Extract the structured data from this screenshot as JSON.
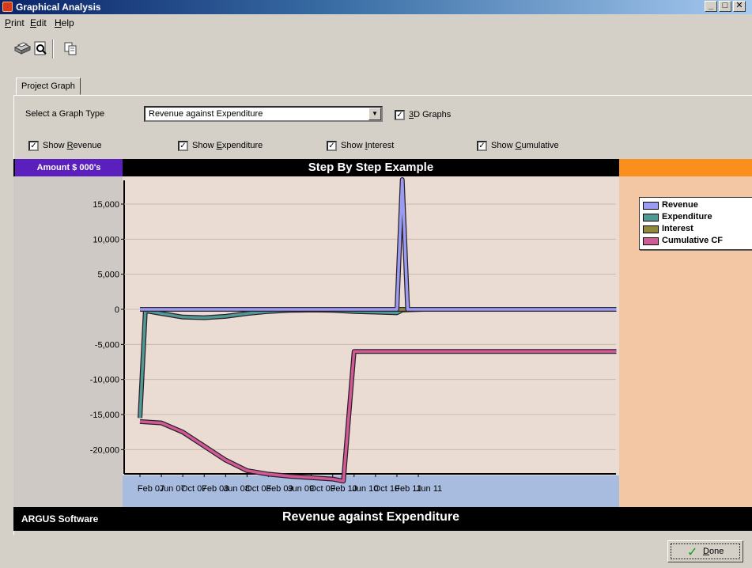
{
  "window": {
    "title": "Graphical Analysis",
    "minimize": "_",
    "maximize": "□",
    "close": "✕"
  },
  "menu": [
    {
      "key": "P",
      "rest": "rint"
    },
    {
      "key": "E",
      "rest": "dit",
      "pre": ""
    },
    {
      "key": "H",
      "rest": "elp"
    }
  ],
  "toolbar": {
    "icons": [
      "printer-icon",
      "print-preview-icon",
      "copy-icon"
    ]
  },
  "tab": {
    "label": "Project Graph"
  },
  "controls": {
    "graph_type_label": "Select a Graph Type",
    "graph_type_value": "Revenue against Expenditure",
    "graphs_3d": {
      "pre": "",
      "key": "3",
      "rest": "D Graphs",
      "checked": true
    },
    "show_revenue": {
      "pre": "Show ",
      "key": "R",
      "rest": "evenue",
      "checked": true
    },
    "show_expenditure": {
      "pre": "Show ",
      "key": "E",
      "rest": "xpenditure",
      "checked": true
    },
    "show_interest": {
      "pre": "Show ",
      "key": "I",
      "rest": "nterest",
      "checked": true
    },
    "show_cumulative": {
      "pre": "Show ",
      "key": "C",
      "rest": "umulative",
      "checked": true
    }
  },
  "chart_header": {
    "y_unit": "Amount $ 000's",
    "title": "Step By Step Example"
  },
  "footer": {
    "brand": "ARGUS Software",
    "title": "Revenue against Expenditure"
  },
  "done_button": {
    "key": "D",
    "rest": "one"
  },
  "colors": {
    "revenue": "#9a9cf2",
    "expenditure": "#4f9a94",
    "interest": "#8f8a3e",
    "cumulative": "#d05a96"
  },
  "chart_data": {
    "type": "line",
    "title": "Step By Step Example",
    "ylabel": "Amount $ 000's",
    "ylim": [
      -25000,
      20000
    ],
    "yticks": [
      15000,
      10000,
      5000,
      0,
      -5000,
      -10000,
      -15000,
      -20000
    ],
    "ytick_labels": [
      "15,000",
      "10,000",
      "5,000",
      "0",
      "-5,000",
      "-10,000",
      "-15,000",
      "-20,000"
    ],
    "x_tick_labels": [
      "Feb 07",
      "Jun 07",
      "Oct 07",
      "Feb 08",
      "Jun 08",
      "Oct 08",
      "Feb 09",
      "Jun 09",
      "Oct 09",
      "Feb 10",
      "Jun 10",
      "Oct 10",
      "Feb 11",
      "Jun 11"
    ],
    "x_months_from_first_period": true,
    "series": [
      {
        "name": "Revenue",
        "points": [
          [
            0,
            0
          ],
          [
            48,
            0
          ],
          [
            49,
            18500
          ],
          [
            50,
            0
          ],
          [
            53,
            0
          ],
          [
            89,
            0
          ]
        ]
      },
      {
        "name": "Expenditure",
        "points": [
          [
            0,
            -15500
          ],
          [
            1,
            -200
          ],
          [
            4,
            -600
          ],
          [
            8,
            -1100
          ],
          [
            12,
            -1200
          ],
          [
            16,
            -1000
          ],
          [
            20,
            -600
          ],
          [
            24,
            -300
          ],
          [
            28,
            -150
          ],
          [
            32,
            -100
          ],
          [
            36,
            -150
          ],
          [
            40,
            -300
          ],
          [
            44,
            -400
          ],
          [
            48,
            -500
          ],
          [
            49,
            -100
          ],
          [
            53,
            0
          ],
          [
            89,
            0
          ]
        ]
      },
      {
        "name": "Interest",
        "points": [
          [
            0,
            0
          ],
          [
            89,
            0
          ]
        ]
      },
      {
        "name": "Cumulative CF",
        "points": [
          [
            0,
            -16000
          ],
          [
            4,
            -16200
          ],
          [
            8,
            -17500
          ],
          [
            12,
            -19500
          ],
          [
            16,
            -21500
          ],
          [
            20,
            -23000
          ],
          [
            24,
            -23500
          ],
          [
            28,
            -23800
          ],
          [
            32,
            -24000
          ],
          [
            36,
            -24200
          ],
          [
            38,
            -24500
          ],
          [
            40,
            -6000
          ],
          [
            89,
            -6000
          ]
        ]
      }
    ],
    "grid": true,
    "legend_position": "right"
  }
}
